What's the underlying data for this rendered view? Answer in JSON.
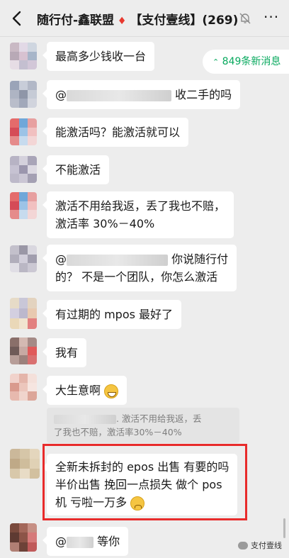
{
  "header": {
    "back_icon": "chevron-left-icon",
    "title_pre": "随行付-鑫联盟",
    "title_post": "【支付壹线】(269)",
    "mute_icon": "bell-off-icon",
    "more_icon": "more-dots-icon",
    "more_glyph": "···"
  },
  "new_messages": {
    "label": "849条新消息",
    "icon": "double-chevron-up-icon"
  },
  "messages": [
    {
      "text": "最高多少钱收一台"
    },
    {
      "prefix": "@",
      "suffix": "收二手的吗"
    },
    {
      "text": "能激活吗？能激活就可以"
    },
    {
      "text": "不能激活"
    },
    {
      "line1": "激活不用给我返，丢了我也不赔，",
      "line2": "激活率 30%－40%"
    },
    {
      "prefix": "@",
      "line1_tail": "你说随行付",
      "line2": "的？  不是一个团队，你怎么激活"
    },
    {
      "text": "有过期的 mpos 最好了"
    },
    {
      "text": "我有"
    },
    {
      "text": "大生意啊"
    },
    {
      "quote_line1": ". 激活不用给我返，丢",
      "quote_line2": "了我也不赔，激活率30%－40%"
    },
    {
      "line1": "全新未拆封的 epos 出售 有要的吗",
      "line2": "半价出售 挽回一点损失 做个 pos",
      "line3": "机 亏啦一万多"
    },
    {
      "prefix": "@",
      "suffix": "等你"
    }
  ],
  "watermark": {
    "label": "支付壹线"
  },
  "colors": {
    "background": "#ededed",
    "bubble": "#ffffff",
    "accent_green": "#07a95e",
    "highlight_red": "#e82b2b"
  }
}
